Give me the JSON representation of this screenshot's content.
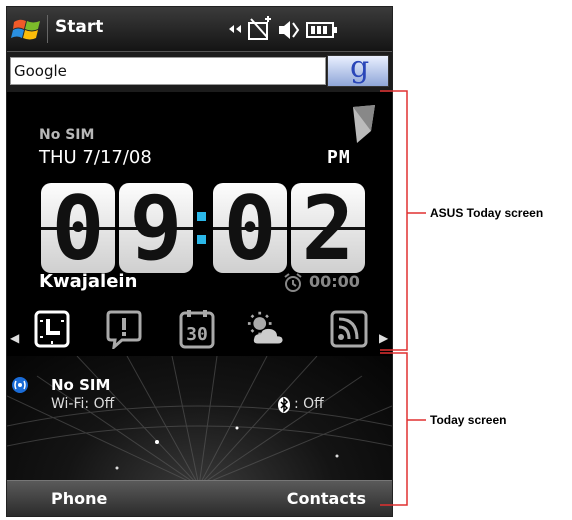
{
  "titlebar": {
    "title": "Start"
  },
  "google": {
    "input_text": "Google",
    "button_glyph": "g"
  },
  "asus_panel": {
    "status_text": "No SIM",
    "date": "THU 7/17/08",
    "ampm": "PM",
    "time_digits": [
      "0",
      "9",
      "0",
      "2"
    ],
    "city": "Kwajalein",
    "alarm_time": "00:00",
    "icons": [
      "clock-icon",
      "notification-icon",
      "calendar-icon",
      "weather-icon",
      "rss-icon"
    ],
    "calendar_day": "30"
  },
  "today_panel": {
    "title": "No SIM",
    "wifi": "Wi-Fi: Off",
    "bluetooth": ": Off"
  },
  "softkeys": {
    "left": "Phone",
    "right": "Contacts"
  },
  "annotations": {
    "asus_label": "ASUS Today screen",
    "today_label": "Today screen"
  },
  "colors": {
    "accent_blue": "#2bb7e8",
    "background": "#000000"
  }
}
